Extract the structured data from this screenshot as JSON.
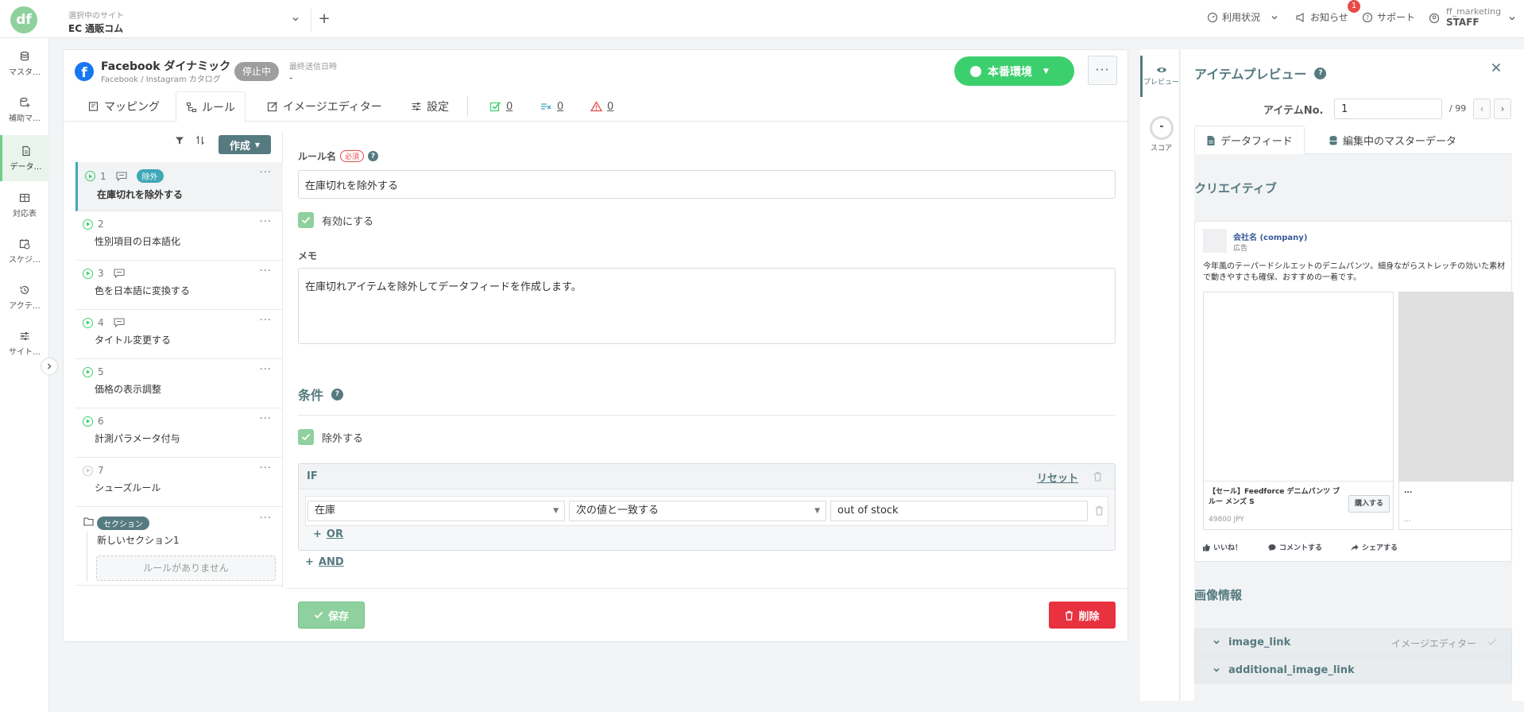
{
  "topbar": {
    "site_label": "選択中のサイト",
    "site_name": "EC 通販コム",
    "usage": "利用状況",
    "notice": "お知らせ",
    "notice_count": "1",
    "support": "サポート",
    "user_name": "ff_marketing",
    "user_role": "STAFF"
  },
  "nav": {
    "items": [
      {
        "label": "マスタ…",
        "icon": "database-icon"
      },
      {
        "label": "補助マ…",
        "icon": "database-plus-icon"
      },
      {
        "label": "データ…",
        "icon": "document-icon"
      },
      {
        "label": "対応表",
        "icon": "table-icon"
      },
      {
        "label": "スケジ…",
        "icon": "schedule-icon"
      },
      {
        "label": "アクテ…",
        "icon": "history-icon"
      },
      {
        "label": "サイト…",
        "icon": "sliders-icon"
      }
    ]
  },
  "feed": {
    "name": "Facebook ダイナミック",
    "sub": "Facebook / Instagram カタログ",
    "status": "停止中",
    "last_sent_label": "最終送信日時",
    "last_sent_value": "-",
    "env_button": "本番環境"
  },
  "tabs": {
    "mapping": "マッピング",
    "rule": "ルール",
    "image_editor": "イメージエディター",
    "settings": "設定",
    "count_ok": "0",
    "count_x": "0",
    "count_warn": "0"
  },
  "rulelist": {
    "create": "作成",
    "items": [
      {
        "num": "1",
        "title": "在庫切れを除外する",
        "badge": "除外"
      },
      {
        "num": "2",
        "title": "性別項目の日本語化"
      },
      {
        "num": "3",
        "title": "色を日本語に変換する"
      },
      {
        "num": "4",
        "title": "タイトル変更する"
      },
      {
        "num": "5",
        "title": "価格の表示調整"
      },
      {
        "num": "6",
        "title": "計測パラメータ付与"
      },
      {
        "num": "7",
        "title": "シューズルール"
      }
    ],
    "section_badge": "セクション",
    "section_name": "新しいセクション1",
    "section_empty": "ルールがありません"
  },
  "form": {
    "rule_name_label": "ルール名",
    "required": "必須",
    "rule_name_value": "在庫切れを除外する",
    "enable_label": "有効にする",
    "memo_label": "メモ",
    "memo_value": "在庫切れアイテムを除外してデータフィードを作成します。",
    "condition_title": "条件",
    "exclude_label": "除外する",
    "if_label": "IF",
    "reset": "リセット",
    "field": "在庫",
    "operator": "次の値と一致する",
    "value": "out of stock",
    "or": "OR",
    "and": "AND",
    "save": "保存",
    "delete": "削除"
  },
  "preview": {
    "side_preview": "プレビュー",
    "side_score": "スコア",
    "score_value": "-",
    "title": "アイテムプレビュー",
    "item_no_label": "アイテムNo.",
    "item_no": "1",
    "item_total": "/ 99",
    "tab_feed": "データフィード",
    "tab_master": "編集中のマスターデータ",
    "creative": "クリエイティブ",
    "ad": {
      "company": "会社名 (company)",
      "sponsored": "広告",
      "body": "今年風のテーパードシルエットのデニムパンツ。細身ながらストレッチの効いた素材で動きやすさも確保、おすすめの一着です。",
      "product_title": "【セール】Feedforce デニムパンツ ブルー メンズ S",
      "price": "49800 JPY",
      "buy": "購入する",
      "second_title": "...",
      "second_price": "...",
      "like": "いいね！",
      "comment": "コメントする",
      "share": "シェアする"
    },
    "image_info": "画像情報",
    "image_link": "image_link",
    "image_editor_link": "イメージエディター",
    "additional_image_link": "additional_image_link"
  }
}
